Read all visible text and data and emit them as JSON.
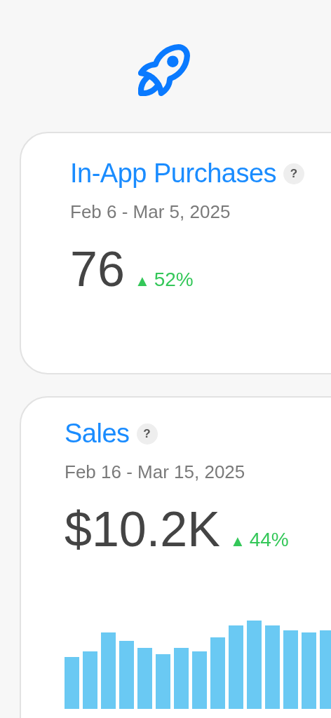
{
  "cards": [
    {
      "kind": "metric",
      "title": "In-App Purchases",
      "help": "?",
      "date_range": "Feb 6 - Mar 5, 2025",
      "value": "76",
      "trend": "▲",
      "change": "52%"
    },
    {
      "kind": "chart",
      "title": "Sales",
      "help": "?",
      "date_range": "Feb 16 - Mar 15, 2025",
      "value": "$10.2K",
      "trend": "▲",
      "change": "44%"
    }
  ]
}
